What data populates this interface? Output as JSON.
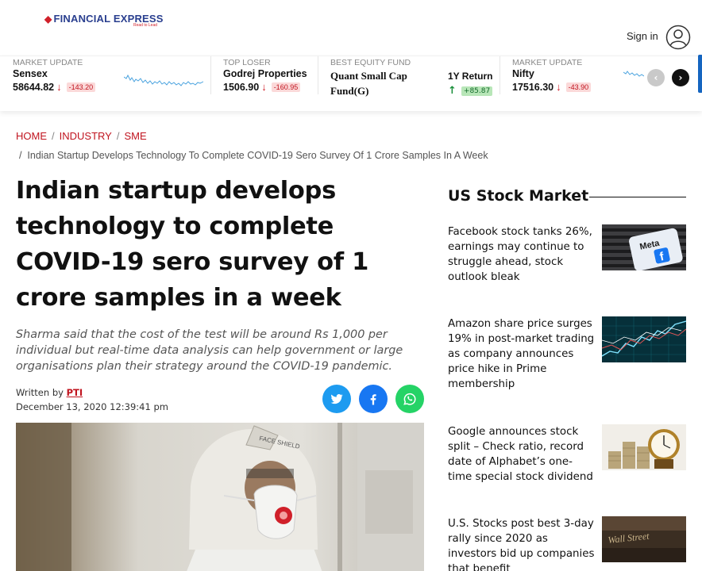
{
  "header": {
    "logo_text": "FINANCIAL EXPRESS",
    "logo_tagline": "Read to Lead",
    "signin_label": "Sign in"
  },
  "ticker": [
    {
      "label": "MARKET UPDATE",
      "name": "Sensex",
      "value": "58644.82",
      "change": "-143.20",
      "direction": "down"
    },
    {
      "label": "TOP LOSER",
      "name": "Godrej Properties",
      "value": "1506.90",
      "change": "-160.95",
      "direction": "down"
    },
    {
      "label": "BEST EQUITY FUND",
      "name_line1": "Quant Small Cap",
      "name_line2": "Fund(G)",
      "return_label": "1Y Return",
      "change": "+85.87",
      "direction": "up"
    },
    {
      "label": "MARKET UPDATE",
      "name": "Nifty",
      "value": "17516.30",
      "change": "-43.90",
      "direction": "down"
    }
  ],
  "breadcrumb": {
    "items": [
      "HOME",
      "INDUSTRY",
      "SME"
    ],
    "current": "Indian Startup Develops Technology To Complete COVID-19 Sero Survey Of 1 Crore Samples In A Week"
  },
  "article": {
    "headline": "Indian startup develops technology to complete COVID-19 sero survey of 1 crore samples in a week",
    "synopsis": "Sharma said that the cost of the test will be around Rs 1,000 per individual but real-time data analysis can help government or large organisations plan their strategy around the COVID-19 pandemic.",
    "written_by_label": "Written by",
    "author": "PTI",
    "date": "December 13, 2020 12:39:41 pm",
    "hero_image_text": "FACE SHIELD"
  },
  "sidebar": {
    "title": "US Stock Market",
    "stories": [
      {
        "text": "Facebook stock tanks 26%, earnings may continue to struggle ahead, stock outlook bleak",
        "image_text": "Meta"
      },
      {
        "text": "Amazon share price surges 19% in post-market trading as company announces price hike in Prime membership",
        "image_text": ""
      },
      {
        "text": "Google announces stock split – Check ratio, record date of Alphabet’s one-time special stock dividend",
        "image_text": ""
      },
      {
        "text": "U.S. Stocks post best 3-day rally since 2020 as investors bid up companies that benefit",
        "image_text": "Wall Street"
      }
    ]
  },
  "colors": {
    "brand_blue": "#2a3f8f",
    "brand_red": "#d0202a",
    "negative": "#c0141f",
    "positive": "#1a8f3a",
    "twitter": "#1d9bf0",
    "facebook": "#1877f2",
    "whatsapp": "#25d366"
  }
}
